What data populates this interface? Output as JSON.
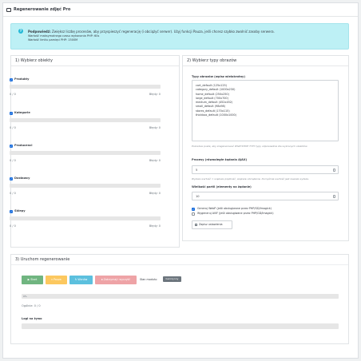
{
  "header": {
    "title": "Regenerowanie zdjęć Pro"
  },
  "alert": {
    "bold": "Podpowiedź:",
    "text": " Zwiększ liczbę procesów, aby przyspieszyć regenerację (i obciążyć serwer). Użyj funkcji Pauza, jeśli chcesz szybko zwolnić zasoby serwera.",
    "line2": "Wartość maksymalnego czasu wykonania PHP: 60s",
    "line3": "Wartość limitu pamięci PHP: 1500M"
  },
  "objects_section": {
    "title": "1) Wybierz obiekty",
    "items": [
      {
        "name": "Produkty",
        "count": "0 / 0",
        "errors": "Błędy: 0",
        "checked": true,
        "progress": 0
      },
      {
        "name": "Kategorie",
        "count": "0 / 0",
        "errors": "Błędy: 0",
        "checked": true,
        "progress": 0
      },
      {
        "name": "Producenci",
        "count": "0 / 0",
        "errors": "Błędy: 0",
        "checked": true,
        "progress": 0
      },
      {
        "name": "Dostawcy",
        "count": "0 / 0",
        "errors": "Błędy: 0",
        "checked": true,
        "progress": 0
      },
      {
        "name": "Sklepy",
        "count": "0 / 0",
        "errors": "Błędy: 0",
        "checked": true,
        "progress": 0
      }
    ]
  },
  "types_section": {
    "title": "2) Wybierz typy obrazów",
    "list_label": "Typy obrazów (wpisz wielokrotny)",
    "types": [
      "cart_default (125x125)",
      "category_default (1000x230)",
      "home_default (250x250)",
      "large_default (700x700)",
      "medium_default (452x452)",
      "small_default (98x98)",
      "stores_default (170x115)",
      "thickbox_default (1000x1000)"
    ],
    "list_hint": "Pozostaw puste, aby zregenerować WSZYSTKIE TYPY typy odpowiednie dla wybranych obiektów.",
    "processes_label": "Procesy (równoległe żądania AJAX)",
    "processes_value": "5",
    "processes_hint": "Wyższa wartość = większa prędkość, większe obciążenie. Domyślnie wartość jest zawsze wyższa.",
    "batch_label": "Wielkość partii (elementy na żądanie)",
    "batch_value": "10",
    "webp_label": "Generuj WebP (jeśli obsługiwane przez PHP/GD/Imagick)",
    "webp_checked": true,
    "avif_label": "Wygeneruj AVIF (jeśli obsługiwane przez PHP/GD/Imagick)",
    "avif_checked": false,
    "save_label": "Zapisz ustawienia"
  },
  "run_section": {
    "title": "3) Uruchom regenerowanie",
    "buttons": {
      "start": "▶ Start",
      "pause": "⏸ Pauza",
      "resume": "↻ Wznów",
      "stop": "⏹ Zatrzymaj i wyczyść"
    },
    "state_label": "Stan modułu:",
    "state_badge": "bezczynny",
    "progress_text": "0%",
    "total": "Ogólnie: 0 / 0",
    "logs_label": "Logi na żywo"
  },
  "colors": {
    "start": "#70b580",
    "pause": "#fcc85f",
    "resume": "#5cc0de",
    "stop": "#eea3a6",
    "alert_bg": "#bdf0f5",
    "checkbox": "#1d6fdd"
  }
}
